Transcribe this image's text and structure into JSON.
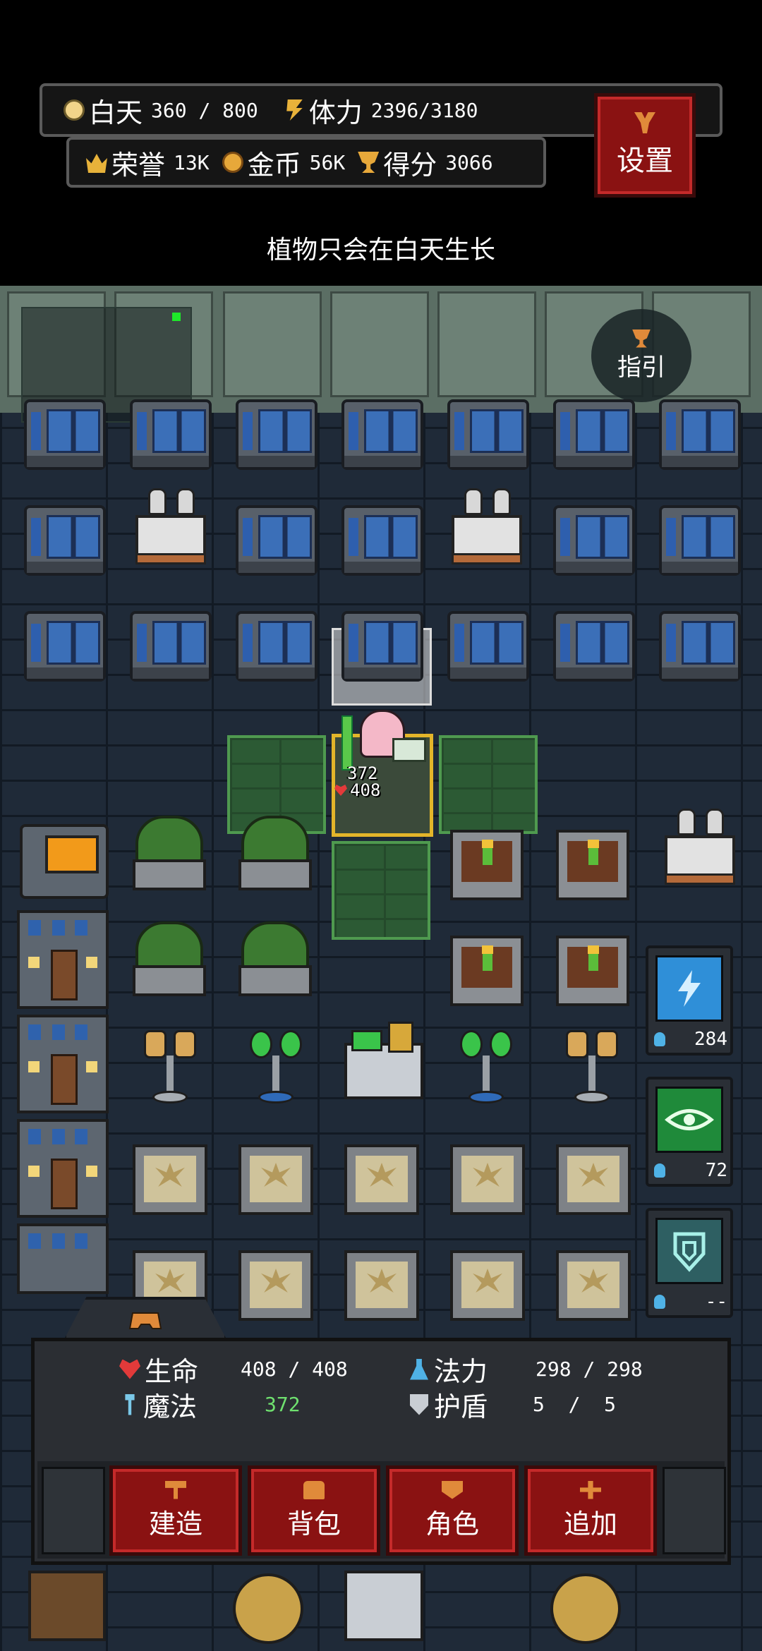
{
  "hud": {
    "day_label": "白天",
    "day_value": "360 / 800",
    "stamina_label": "体力",
    "stamina_value": "2396/3180",
    "honor_label": "荣誉",
    "honor_value": "13K",
    "coins_label": "金币",
    "coins_value": "56K",
    "score_label": "得分",
    "score_value": "3066",
    "settings_label": "设置"
  },
  "hint": "植物只会在白天生长",
  "guide_label": "指引",
  "player": {
    "magic_value": "372",
    "hp_value": "408"
  },
  "skills": [
    {
      "icon": "lightning-rune-icon",
      "cost": "284",
      "color": "#2f8fd8"
    },
    {
      "icon": "eye-rune-icon",
      "cost": "72",
      "color": "#1f8a3a"
    },
    {
      "icon": "shield-rune-icon",
      "cost": "--",
      "color": "#3aa0a0"
    }
  ],
  "status": {
    "hp_label": "生命",
    "hp_value": "408 / 408",
    "mana_label": "法力",
    "mana_value": "298 / 298",
    "magic_label": "魔法",
    "magic_value": "372",
    "shield_label": "护盾",
    "shield_value": "5  /  5"
  },
  "actions": {
    "build": "建造",
    "bag": "背包",
    "character": "角色",
    "add": "追加"
  },
  "colors": {
    "accent_red": "#8a1212",
    "grass_green": "#2c5a34",
    "select_gold": "#e3b52a"
  }
}
